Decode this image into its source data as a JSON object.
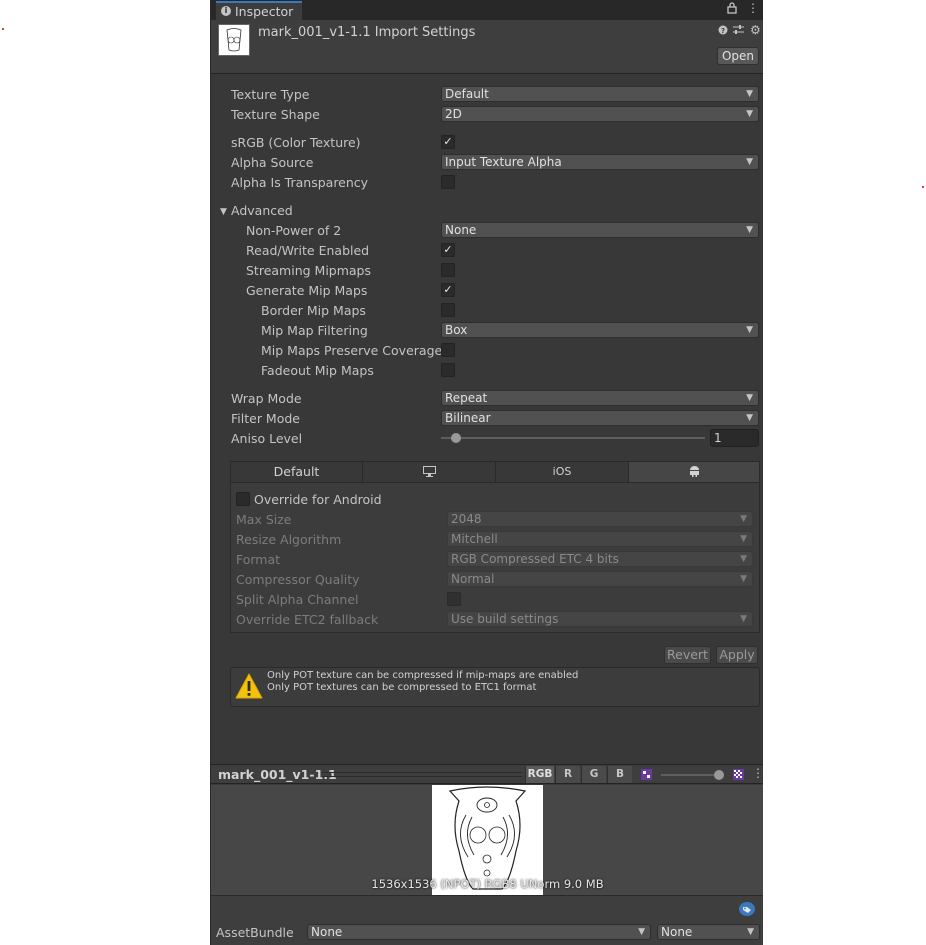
{
  "window": {
    "tab_title": "Inspector"
  },
  "header": {
    "title": "mark_001_v1-1.1 Import Settings",
    "open_label": "Open"
  },
  "settings": {
    "texture_type": {
      "label": "Texture Type",
      "value": "Default"
    },
    "texture_shape": {
      "label": "Texture Shape",
      "value": "2D"
    },
    "srgb": {
      "label": "sRGB (Color Texture)",
      "checked": true
    },
    "alpha_source": {
      "label": "Alpha Source",
      "value": "Input Texture Alpha"
    },
    "alpha_transparency": {
      "label": "Alpha Is Transparency",
      "checked": false
    },
    "advanced": {
      "label": "Advanced",
      "non_power_of_2": {
        "label": "Non-Power of 2",
        "value": "None"
      },
      "read_write": {
        "label": "Read/Write Enabled",
        "checked": true
      },
      "streaming_mipmaps": {
        "label": "Streaming Mipmaps",
        "checked": false
      },
      "generate_mipmaps": {
        "label": "Generate Mip Maps",
        "checked": true
      },
      "border_mipmaps": {
        "label": "Border Mip Maps",
        "checked": false
      },
      "mipmap_filtering": {
        "label": "Mip Map Filtering",
        "value": "Box"
      },
      "preserve_coverage": {
        "label": "Mip Maps Preserve Coverage",
        "checked": false
      },
      "fadeout_mipmaps": {
        "label": "Fadeout Mip Maps",
        "checked": false
      }
    },
    "wrap_mode": {
      "label": "Wrap Mode",
      "value": "Repeat"
    },
    "filter_mode": {
      "label": "Filter Mode",
      "value": "Bilinear"
    },
    "aniso_level": {
      "label": "Aniso Level",
      "value": "1",
      "fraction": 0.0
    }
  },
  "platform_tabs": {
    "default_label": "Default",
    "ios_label": "iOS",
    "selected": "android",
    "icons": [
      "monitor-icon",
      "android-icon"
    ]
  },
  "android": {
    "override_label": "Override for Android",
    "override_checked": false,
    "max_size": {
      "label": "Max Size",
      "value": "2048"
    },
    "resize_algorithm": {
      "label": "Resize Algorithm",
      "value": "Mitchell"
    },
    "format": {
      "label": "Format",
      "value": "RGB Compressed ETC 4 bits"
    },
    "compressor_quality": {
      "label": "Compressor Quality",
      "value": "Normal"
    },
    "split_alpha": {
      "label": "Split Alpha Channel",
      "checked": false
    },
    "etc2_fallback": {
      "label": "Override ETC2 fallback",
      "value": "Use build settings"
    }
  },
  "actions": {
    "revert_label": "Revert",
    "apply_label": "Apply"
  },
  "help": {
    "line1": "Only POT texture can be compressed if mip-maps are enabled",
    "line2": "Only POT textures can be compressed to ETC1 format",
    "icon": "warning-icon"
  },
  "preview": {
    "name": "mark_001_v1-1.1",
    "channels": [
      "RGB",
      "R",
      "G",
      "B"
    ],
    "active_channel": "RGB",
    "info": "1536x1536 (NPOT)  RGB8 UNorm   9.0 MB",
    "mip_fraction": 0.97
  },
  "asset_bundle": {
    "label": "AssetBundle",
    "name_value": "None",
    "variant_value": "None"
  },
  "colors": {
    "panel": "#383838",
    "accent": "#3a79bb",
    "warning": "#f4c20d"
  }
}
